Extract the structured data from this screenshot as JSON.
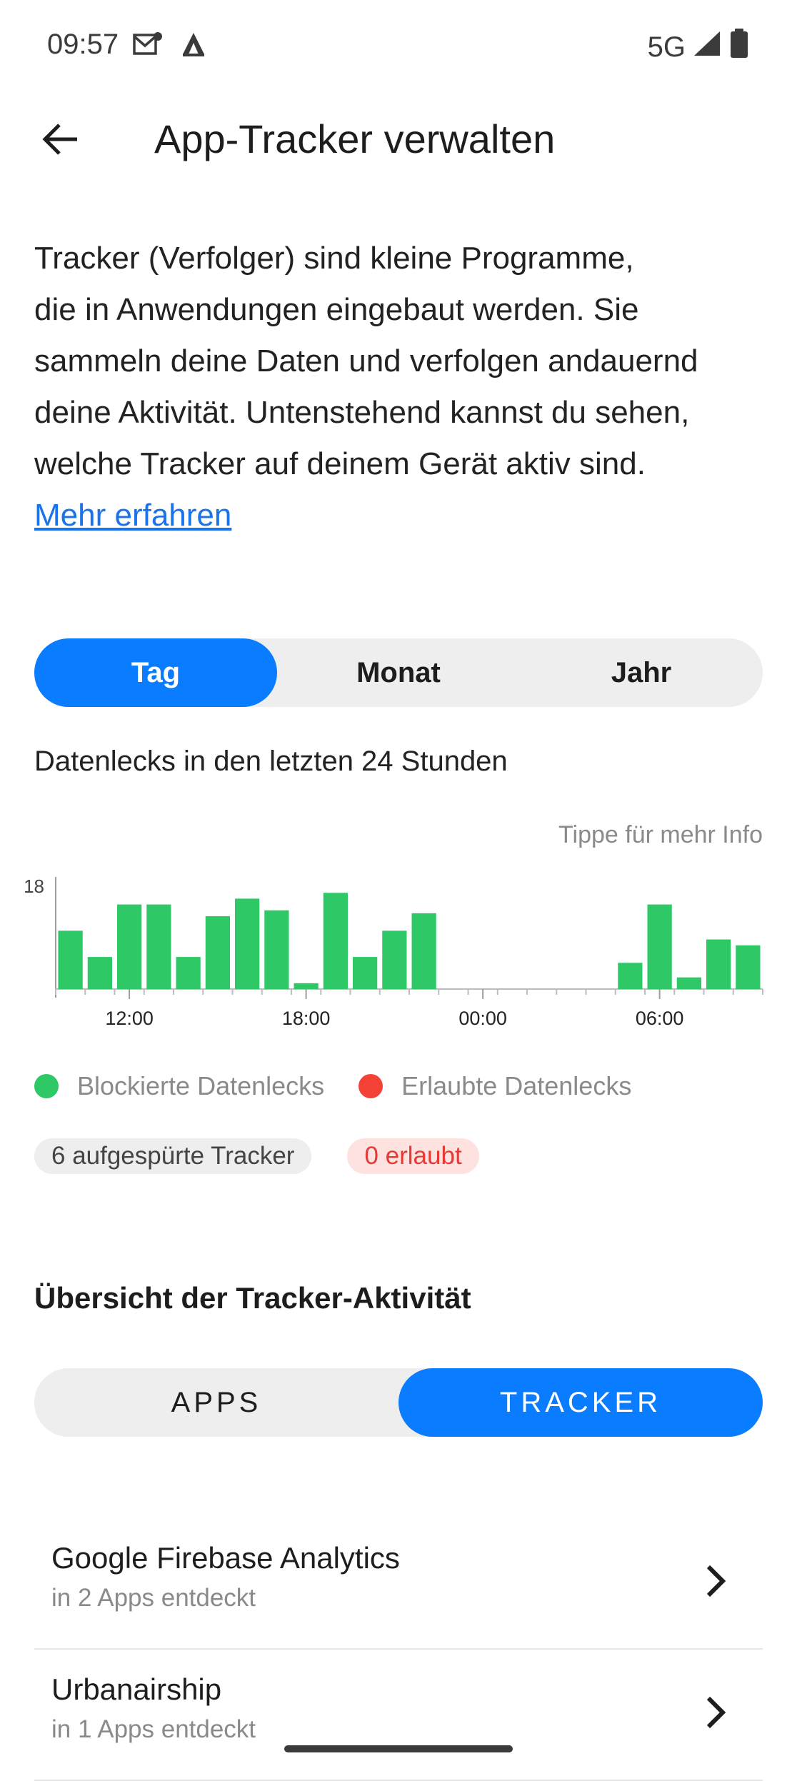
{
  "status_bar": {
    "time": "09:57",
    "network": "5G",
    "icons": [
      "mail-icon",
      "app-notification-icon",
      "signal-icon",
      "battery-icon"
    ]
  },
  "header": {
    "title": "App-Tracker verwalten",
    "back_icon": "arrow-left-icon"
  },
  "intro": {
    "lines": [
      "Tracker (Verfolger) sind kleine Programme,",
      "die in Anwendungen eingebaut werden. Sie",
      "sammeln deine Daten und verfolgen andauernd",
      "deine Aktivität. Untenstehend kannst du sehen,",
      "welche Tracker auf deinem Gerät aktiv sind."
    ],
    "link": "Mehr erfahren"
  },
  "period_tabs": {
    "items": [
      "Tag",
      "Monat",
      "Jahr"
    ],
    "selected": "Tag"
  },
  "chart_section": {
    "label": "Datenlecks in den letzten 24 Stunden",
    "hint": "Tippe für mehr Info"
  },
  "chart_data": {
    "type": "bar",
    "title": "",
    "xlabel": "",
    "ylabel": "",
    "ylim": [
      0,
      18
    ],
    "y_tick_labels": [
      "18"
    ],
    "x_tick_labels": [
      "12:00",
      "18:00",
      "00:00",
      "06:00"
    ],
    "categories": [
      "10:00",
      "11:00",
      "12:00",
      "13:00",
      "14:00",
      "15:00",
      "16:00",
      "17:00",
      "18:00",
      "19:00",
      "20:00",
      "21:00",
      "22:00",
      "23:00",
      "00:00",
      "01:00",
      "02:00",
      "03:00",
      "04:00",
      "05:00",
      "06:00",
      "07:00",
      "08:00",
      "09:00"
    ],
    "series": [
      {
        "name": "Blockierte Datenlecks",
        "color": "#2ec866",
        "values": [
          10,
          5.5,
          14.5,
          14.5,
          5.5,
          12.5,
          15.5,
          13.5,
          1,
          16.5,
          5.5,
          10,
          13,
          0,
          0,
          0,
          0,
          0,
          0,
          4.5,
          14.5,
          2,
          8.5,
          7.5
        ]
      },
      {
        "name": "Erlaubte Datenlecks",
        "color": "#f44336",
        "values": [
          0,
          0,
          0,
          0,
          0,
          0,
          0,
          0,
          0,
          0,
          0,
          0,
          0,
          0,
          0,
          0,
          0,
          0,
          0,
          0,
          0,
          0,
          0,
          0
        ]
      }
    ],
    "legend_placement": "bottom",
    "grid": false
  },
  "legend": {
    "blocked_label": "Blockierte Datenlecks",
    "blocked_color": "#2ec866",
    "allowed_label": "Erlaubte Datenlecks",
    "allowed_color": "#f44336"
  },
  "badges": {
    "detected": "6 aufgespürte Tracker",
    "allowed": "0 erlaubt"
  },
  "overview": {
    "title": "Übersicht der Tracker-Aktivität",
    "tabs": [
      "APPS",
      "TRACKER"
    ],
    "selected": "TRACKER"
  },
  "trackers": [
    {
      "name": "Google Firebase Analytics",
      "subtitle": "in 2 Apps entdeckt"
    },
    {
      "name": "Urbanairship",
      "subtitle": "in 1 Apps entdeckt"
    }
  ],
  "colors": {
    "accent": "#0a7cff",
    "link": "#1a73e8",
    "blocked": "#2ec866",
    "allowed": "#f44336"
  }
}
